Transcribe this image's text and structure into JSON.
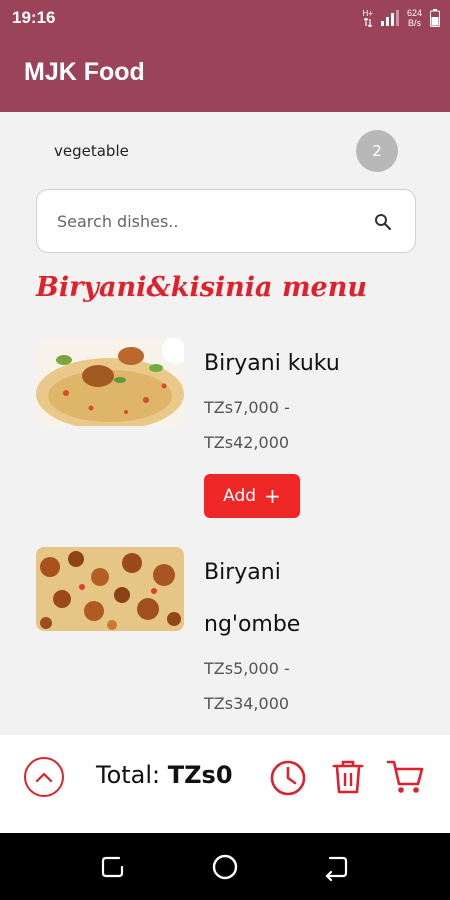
{
  "status_bar": {
    "time": "19:16",
    "network_type": "H+",
    "speed_value": "624",
    "speed_unit": "B/s",
    "icons": [
      "data-arrows-icon",
      "signal-icon",
      "battery-icon"
    ]
  },
  "app_bar": {
    "title": "MJK Food"
  },
  "category": {
    "label": "vegetable",
    "count": "2"
  },
  "search": {
    "placeholder": "Search dishes..",
    "value": ""
  },
  "menu": {
    "heading": "Biryani&kisinia menu",
    "dishes": [
      {
        "name": "Biryani kuku",
        "price_line_1": "TZs7,000 -",
        "price_line_2": "TZs42,000",
        "add_label": "Add",
        "add_icon": "+"
      },
      {
        "name_line_1": "Biryani",
        "name_line_2": "ng'ombe",
        "price_line_1": "TZs5,000 -",
        "price_line_2": "TZs34,000"
      }
    ]
  },
  "bottom_bar": {
    "total_label": "Total: ",
    "total_value": "TZs0"
  },
  "colors": {
    "primary": "#9b4358",
    "accent": "#e0202c",
    "add_button": "#ee2626"
  }
}
